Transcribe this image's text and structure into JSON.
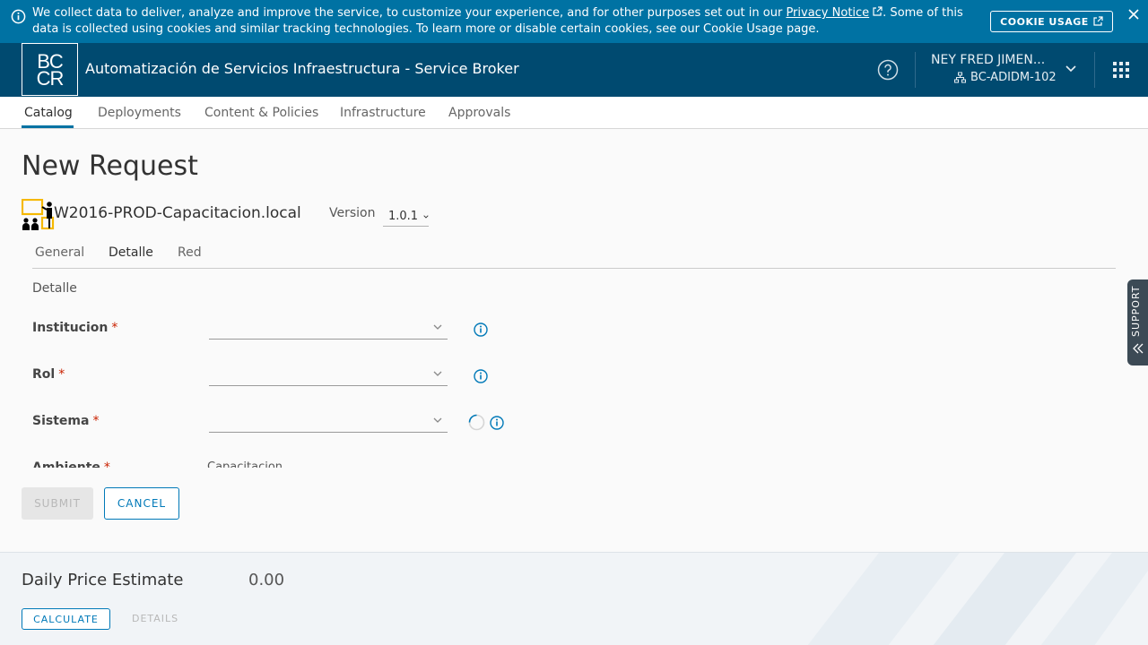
{
  "cookie_banner": {
    "message_before_link": "We collect data to deliver, analyze and improve the service, to customize your experience, and for other purposes set out in our ",
    "link_text": "Privacy Notice",
    "message_after_link": ". Some of this data is collected using cookies and similar tracking technologies. To learn more or disable certain cookies, see our Cookie Usage page.",
    "usage_button": "COOKIE USAGE"
  },
  "header": {
    "logo_top": "BC",
    "logo_bottom": "CR",
    "app_title": "Automatización de Servicios Infraestructura - Service Broker",
    "user_name": "NEY FRED JIMEN...",
    "user_org": "BC-ADIDM-102"
  },
  "nav": {
    "tabs": [
      "Catalog",
      "Deployments",
      "Content & Policies",
      "Infrastructure",
      "Approvals"
    ],
    "active": "Catalog"
  },
  "page": {
    "title": "New Request",
    "blueprint_name": "W2016-PROD-Capacitacion.local",
    "version_label": "Version",
    "version_value": "1.0.1"
  },
  "subtabs": [
    "General",
    "Detalle",
    "Red"
  ],
  "active_subtab": "Detalle",
  "section_label": "Detalle",
  "form": {
    "fields": [
      {
        "label": "Institucion",
        "required": "*",
        "value": ""
      },
      {
        "label": "Rol",
        "required": "*",
        "value": ""
      },
      {
        "label": "Sistema",
        "required": "*",
        "value": ""
      },
      {
        "label": "Ambiente",
        "required": "*",
        "value": "Capacitacion"
      }
    ]
  },
  "buttons": {
    "submit": "SUBMIT",
    "cancel": "CANCEL"
  },
  "footer": {
    "price_label": "Daily Price Estimate",
    "price_value": "0.00",
    "calculate": "CALCULATE",
    "details": "DETAILS"
  },
  "support_tab": "SUPPORT",
  "colors": {
    "banner": "#0072a3",
    "header": "#004a70",
    "accent": "#0079b8",
    "required": "#c92100",
    "logo_icon_yellow": "#f5b800"
  }
}
